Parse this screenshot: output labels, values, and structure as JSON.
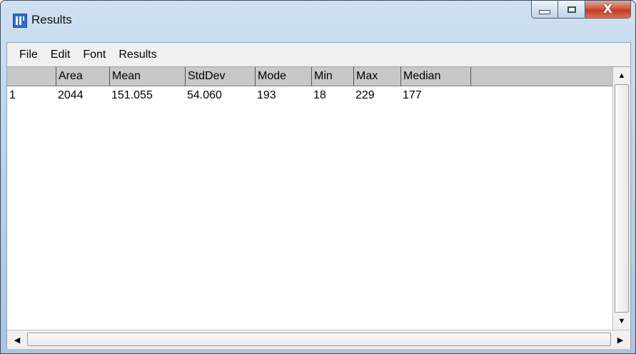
{
  "window": {
    "title": "Results",
    "app_icon": "imagej-icon",
    "controls": {
      "minimize": "minimize-icon",
      "maximize": "maximize-icon",
      "close_label": "X"
    }
  },
  "menubar": {
    "items": [
      {
        "label": "File"
      },
      {
        "label": "Edit"
      },
      {
        "label": "Font"
      },
      {
        "label": "Results"
      }
    ]
  },
  "table": {
    "columns": [
      "",
      "Area",
      "Mean",
      "StdDev",
      "Mode",
      "Min",
      "Max",
      "Median"
    ],
    "rows": [
      [
        "1",
        "2044",
        "151.055",
        "54.060",
        "193",
        "18",
        "229",
        "177"
      ]
    ]
  },
  "scrollbars": {
    "vertical": {
      "up_icon": "arrow-up-icon",
      "down_icon": "arrow-down-icon"
    },
    "horizontal": {
      "left_icon": "arrow-left-icon",
      "right_icon": "arrow-right-icon"
    }
  }
}
